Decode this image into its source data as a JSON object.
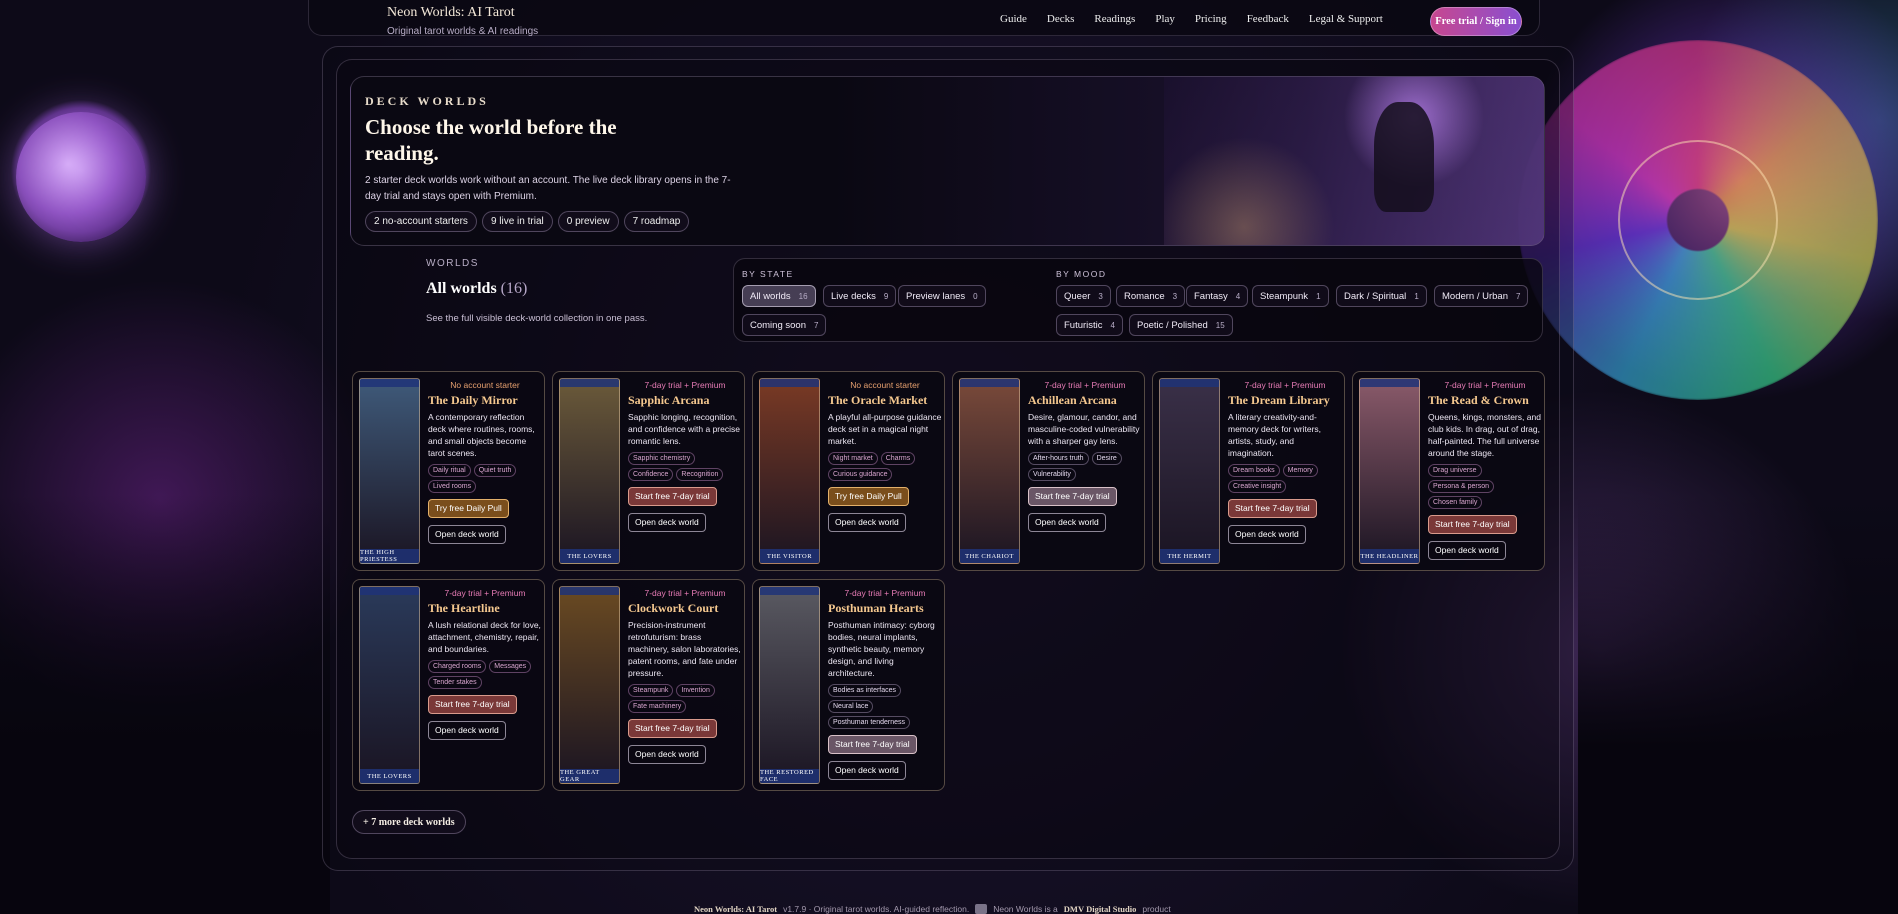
{
  "header": {
    "brand_title": "Neon Worlds: AI Tarot",
    "brand_subtitle": "Original tarot worlds & AI readings",
    "nav": [
      "Guide",
      "Decks",
      "Readings",
      "Play",
      "Pricing",
      "Feedback",
      "Legal & Support"
    ],
    "cta": "Free trial / Sign in"
  },
  "hero": {
    "eyebrow": "DECK WORLDS",
    "title": "Choose the world before the reading.",
    "description": "2 starter deck worlds work without an account. The live deck library opens in the 7-day trial and stays open with Premium.",
    "pills": [
      "2 no-account starters",
      "9 live in trial",
      "0 preview",
      "7 roadmap"
    ]
  },
  "worlds": {
    "label": "WORLDS",
    "title": "All worlds",
    "count": "(16)",
    "subtitle": "See the full visible deck-world collection in one pass."
  },
  "filters": {
    "state_label": "BY STATE",
    "mood_label": "BY MOOD",
    "state": [
      {
        "label": "All worlds",
        "count": "16"
      },
      {
        "label": "Live decks",
        "count": "9"
      },
      {
        "label": "Preview lanes",
        "count": "0"
      },
      {
        "label": "Coming soon",
        "count": "7"
      }
    ],
    "mood": [
      {
        "label": "Queer",
        "count": "3"
      },
      {
        "label": "Romance",
        "count": "3"
      },
      {
        "label": "Fantasy",
        "count": "4"
      },
      {
        "label": "Steampunk",
        "count": "1"
      },
      {
        "label": "Dark / Spiritual",
        "count": "1"
      },
      {
        "label": "Modern / Urban",
        "count": "7"
      },
      {
        "label": "Futuristic",
        "count": "4"
      },
      {
        "label": "Poetic / Polished",
        "count": "15"
      }
    ]
  },
  "cards": [
    {
      "tier": "No account starter",
      "name": "The Daily Mirror",
      "desc": "A contemporary reflection deck where routines, rooms, and small objects become tarot scenes.",
      "tags": [
        "Daily ritual",
        "Quiet truth",
        "Lived rooms"
      ],
      "primary": "Try free Daily Pull",
      "secondary": "Open deck world",
      "caption": "THE HIGH PRIESTESS",
      "art": "#3f5a7a"
    },
    {
      "tier": "7-day trial + Premium",
      "name": "Sapphic Arcana",
      "desc": "Sapphic longing, recognition, and confidence with a precise romantic lens.",
      "tags": [
        "Sapphic chemistry",
        "Confidence",
        "Recognition"
      ],
      "primary": "Start free 7-day trial",
      "secondary": "Open deck world",
      "caption": "THE LOVERS",
      "art": "#6b5a3a"
    },
    {
      "tier": "No account starter",
      "name": "The Oracle Market",
      "desc": "A playful all-purpose guidance deck set in a magical night market.",
      "tags": [
        "Night market",
        "Charms",
        "Curious guidance"
      ],
      "primary": "Try free Daily Pull",
      "secondary": "Open deck world",
      "caption": "THE VISITOR",
      "art": "#7a3a24"
    },
    {
      "tier": "7-day trial + Premium",
      "name": "Achillean Arcana",
      "desc": "Desire, glamour, candor, and masculine-coded vulnerability with a sharper gay lens.",
      "tags": [
        "After-hours truth",
        "Desire",
        "Vulnerability"
      ],
      "primary": "Start free 7-day trial",
      "secondary": "Open deck world",
      "caption": "THE CHARIOT",
      "art": "#7a4a3a"
    },
    {
      "tier": "7-day trial + Premium",
      "name": "The Dream Library",
      "desc": "A literary creativity-and-memory deck for writers, artists, study, and imagination.",
      "tags": [
        "Dream books",
        "Memory",
        "Creative insight"
      ],
      "primary": "Start free 7-day trial",
      "secondary": "Open deck world",
      "caption": "THE HERMIT",
      "art": "#3a3048"
    },
    {
      "tier": "7-day trial + Premium",
      "name": "The Read & Crown",
      "desc": "Queens, kings, monsters, and club kids. In drag, out of drag, half-painted. The full universe around the stage.",
      "tags": [
        "Drag universe",
        "Persona & person",
        "Chosen family"
      ],
      "primary": "Start free 7-day trial",
      "secondary": "Open deck world",
      "caption": "THE HEADLINER",
      "art": "#8a5a6a"
    },
    {
      "tier": "7-day trial + Premium",
      "name": "The Heartline",
      "desc": "A lush relational deck for love, attachment, chemistry, repair, and boundaries.",
      "tags": [
        "Charged rooms",
        "Messages",
        "Tender stakes"
      ],
      "primary": "Start free 7-day trial",
      "secondary": "Open deck world",
      "caption": "THE LOVERS",
      "art": "#2a3a5a"
    },
    {
      "tier": "7-day trial + Premium",
      "name": "Clockwork Court",
      "desc": "Precision-instrument retrofuturism: brass machinery, salon laboratories, patent rooms, and fate under pressure.",
      "tags": [
        "Steampunk",
        "Invention",
        "Fate machinery"
      ],
      "primary": "Start free 7-day trial",
      "secondary": "Open deck world",
      "caption": "THE GREAT GEAR",
      "art": "#6a4a22"
    },
    {
      "tier": "7-day trial + Premium",
      "name": "Posthuman Hearts",
      "desc": "Posthuman intimacy: cyborg bodies, neural implants, synthetic beauty, memory design, and living architecture.",
      "tags": [
        "Bodies as interfaces",
        "Neural lace",
        "Posthuman tenderness"
      ],
      "primary": "Start free 7-day trial",
      "secondary": "Open deck world",
      "caption": "THE RESTORED FACE",
      "art": "#5a5a62"
    }
  ],
  "more_button": "+ 7 more deck worlds",
  "footer": {
    "brand": "Neon Worlds: AI Tarot",
    "version": "v1.7.9 · Original tarot worlds. AI-guided reflection.",
    "company_prefix": "Neon Worlds is a",
    "company": "DMV Digital Studio",
    "company_suffix": "product"
  }
}
